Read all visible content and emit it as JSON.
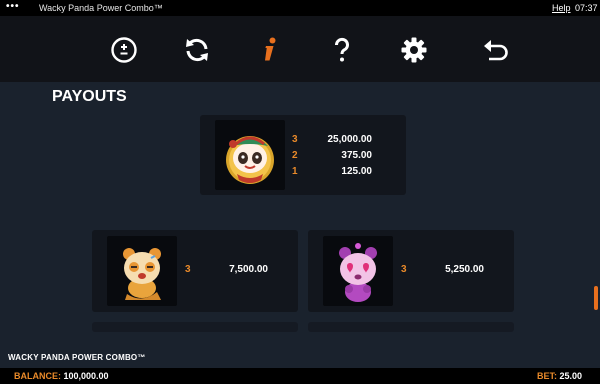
{
  "titlebar": {
    "dots": "•••",
    "app_title": "Wacky Panda Power Combo™",
    "help": "Help",
    "clock": "07:37"
  },
  "toolbar": {
    "icons": [
      "bet-adjust-icon",
      "autoplay-icon",
      "info-icon",
      "help-icon",
      "settings-icon",
      "back-icon"
    ],
    "accent": "#e8701e",
    "icon_color": "#ffffff"
  },
  "content": {
    "title": "PAYOUTS",
    "top_card": {
      "symbol": "wild-panda-icon",
      "rows": [
        {
          "count": "3",
          "value": "25,000.00"
        },
        {
          "count": "2",
          "value": "375.00"
        },
        {
          "count": "1",
          "value": "125.00"
        }
      ]
    },
    "left_card": {
      "symbol": "orange-panda-icon",
      "rows": [
        {
          "count": "3",
          "value": "7,500.00"
        }
      ]
    },
    "right_card": {
      "symbol": "pink-panda-icon",
      "rows": [
        {
          "count": "3",
          "value": "5,250.00"
        }
      ]
    }
  },
  "brand": {
    "text": "WACKY PANDA POWER COMBO™"
  },
  "statusbar": {
    "balance_label": "BALANCE:",
    "balance_value": "100,000.00",
    "bet_label": "BET:",
    "bet_value": "25.00"
  }
}
